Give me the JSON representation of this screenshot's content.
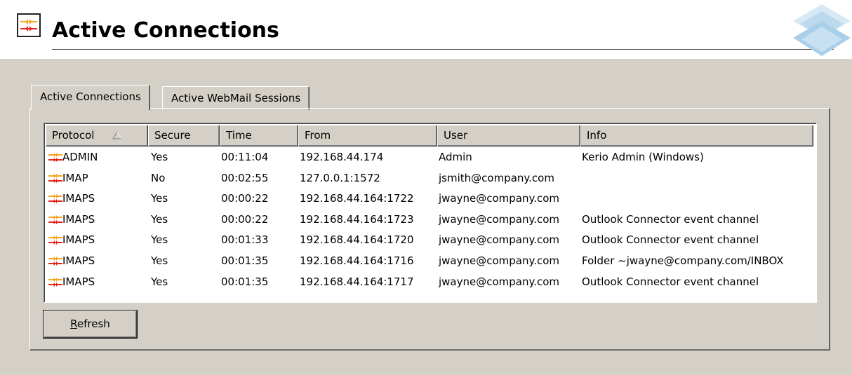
{
  "header": {
    "title": "Active Connections",
    "icon": "active-connections-icon",
    "logo": "kerio-logo"
  },
  "tabs": [
    {
      "label": "Active Connections",
      "active": true
    },
    {
      "label": "Active WebMail Sessions",
      "active": false
    }
  ],
  "table": {
    "columns": [
      "Protocol",
      "Secure",
      "Time",
      "From",
      "User",
      "Info"
    ],
    "sort_column": "Protocol",
    "rows": [
      {
        "protocol": "ADMIN",
        "secure": "Yes",
        "time": "00:11:04",
        "from": "192.168.44.174",
        "user": "Admin",
        "info": "Kerio Admin (Windows)"
      },
      {
        "protocol": "IMAP",
        "secure": "No",
        "time": "00:02:55",
        "from": "127.0.0.1:1572",
        "user": "jsmith@company.com",
        "info": ""
      },
      {
        "protocol": "IMAPS",
        "secure": "Yes",
        "time": "00:00:22",
        "from": "192.168.44.164:1722",
        "user": "jwayne@company.com",
        "info": ""
      },
      {
        "protocol": "IMAPS",
        "secure": "Yes",
        "time": "00:00:22",
        "from": "192.168.44.164:1723",
        "user": "jwayne@company.com",
        "info": "Outlook Connector event channel"
      },
      {
        "protocol": "IMAPS",
        "secure": "Yes",
        "time": "00:01:33",
        "from": "192.168.44.164:1720",
        "user": "jwayne@company.com",
        "info": "Outlook Connector event channel"
      },
      {
        "protocol": "IMAPS",
        "secure": "Yes",
        "time": "00:01:35",
        "from": "192.168.44.164:1716",
        "user": "jwayne@company.com",
        "info": "Folder ~jwayne@company.com/INBOX"
      },
      {
        "protocol": "IMAPS",
        "secure": "Yes",
        "time": "00:01:35",
        "from": "192.168.44.164:1717",
        "user": "jwayne@company.com",
        "info": "Outlook Connector event channel"
      }
    ]
  },
  "buttons": {
    "refresh_label_prefix": "R",
    "refresh_label_rest": "efresh"
  },
  "colors": {
    "window_bg": "#d4d0c8",
    "accent_orange": "#f5a623",
    "accent_red": "#e0281e"
  }
}
